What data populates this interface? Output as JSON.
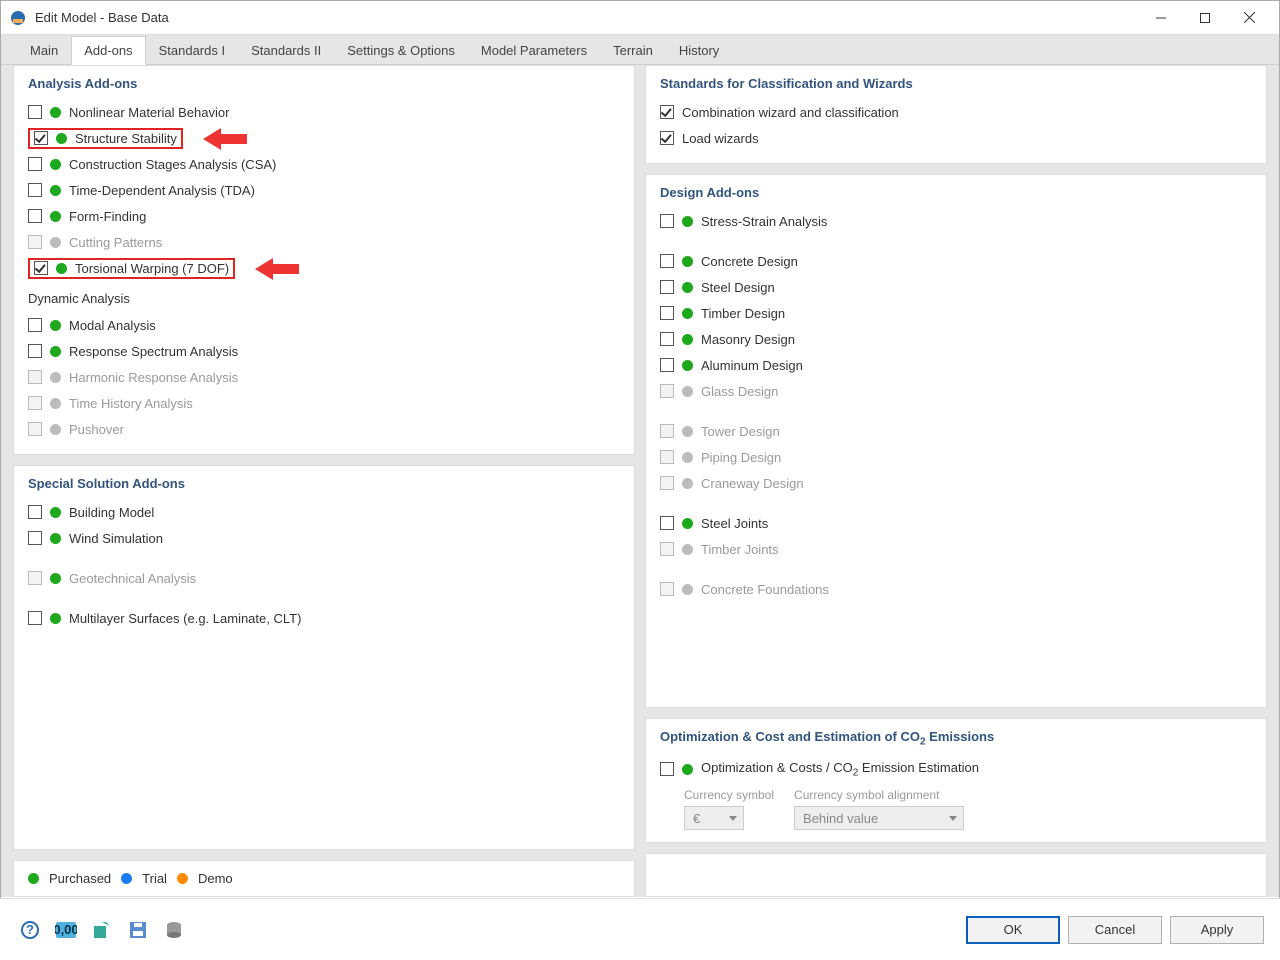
{
  "window": {
    "title": "Edit Model - Base Data"
  },
  "tabs": [
    {
      "label": "Main"
    },
    {
      "label": "Add-ons",
      "active": true
    },
    {
      "label": "Standards I"
    },
    {
      "label": "Standards II"
    },
    {
      "label": "Settings & Options"
    },
    {
      "label": "Model Parameters"
    },
    {
      "label": "Terrain"
    },
    {
      "label": "History"
    }
  ],
  "left": {
    "analysis_title": "Analysis Add-ons",
    "analysis": [
      {
        "label": "Nonlinear Material Behavior",
        "checked": false,
        "status": "green",
        "disabled": false,
        "highlight": false
      },
      {
        "label": "Structure Stability",
        "checked": true,
        "status": "green",
        "disabled": false,
        "highlight": true
      },
      {
        "label": "Construction Stages Analysis (CSA)",
        "checked": false,
        "status": "green",
        "disabled": false,
        "highlight": false
      },
      {
        "label": "Time-Dependent Analysis (TDA)",
        "checked": false,
        "status": "green",
        "disabled": false,
        "highlight": false
      },
      {
        "label": "Form-Finding",
        "checked": false,
        "status": "green",
        "disabled": false,
        "highlight": false
      },
      {
        "label": "Cutting Patterns",
        "checked": false,
        "status": "grey",
        "disabled": true,
        "highlight": false
      },
      {
        "label": "Torsional Warping (7 DOF)",
        "checked": true,
        "status": "green",
        "disabled": false,
        "highlight": true
      }
    ],
    "dynamic_title": "Dynamic Analysis",
    "dynamic": [
      {
        "label": "Modal Analysis",
        "checked": false,
        "status": "green",
        "disabled": false
      },
      {
        "label": "Response Spectrum Analysis",
        "checked": false,
        "status": "green",
        "disabled": false
      },
      {
        "label": "Harmonic Response Analysis",
        "checked": false,
        "status": "grey",
        "disabled": true
      },
      {
        "label": "Time History Analysis",
        "checked": false,
        "status": "grey",
        "disabled": true
      },
      {
        "label": "Pushover",
        "checked": false,
        "status": "grey",
        "disabled": true
      }
    ],
    "special_title": "Special Solution Add-ons",
    "special": [
      {
        "label": "Building Model",
        "checked": false,
        "status": "green",
        "disabled": false,
        "gap": false
      },
      {
        "label": "Wind Simulation",
        "checked": false,
        "status": "green",
        "disabled": false,
        "gap": false
      },
      {
        "label": "Geotechnical Analysis",
        "checked": false,
        "status": "green",
        "disabled": true,
        "gap": true
      },
      {
        "label": "Multilayer Surfaces (e.g. Laminate, CLT)",
        "checked": false,
        "status": "green",
        "disabled": false,
        "gap": true
      }
    ]
  },
  "right": {
    "standards_title": "Standards for Classification and Wizards",
    "standards": [
      {
        "label": "Combination wizard and classification",
        "checked": true
      },
      {
        "label": "Load wizards",
        "checked": true
      }
    ],
    "design_title": "Design Add-ons",
    "design": [
      {
        "label": "Stress-Strain Analysis",
        "checked": false,
        "status": "green",
        "disabled": false,
        "gap": false
      },
      {
        "label": "Concrete Design",
        "checked": false,
        "status": "green",
        "disabled": false,
        "gap": true
      },
      {
        "label": "Steel Design",
        "checked": false,
        "status": "green",
        "disabled": false,
        "gap": false
      },
      {
        "label": "Timber Design",
        "checked": false,
        "status": "green",
        "disabled": false,
        "gap": false
      },
      {
        "label": "Masonry Design",
        "checked": false,
        "status": "green",
        "disabled": false,
        "gap": false
      },
      {
        "label": "Aluminum Design",
        "checked": false,
        "status": "green",
        "disabled": false,
        "gap": false
      },
      {
        "label": "Glass Design",
        "checked": false,
        "status": "grey",
        "disabled": true,
        "gap": false
      },
      {
        "label": "Tower Design",
        "checked": false,
        "status": "grey",
        "disabled": true,
        "gap": true
      },
      {
        "label": "Piping Design",
        "checked": false,
        "status": "grey",
        "disabled": true,
        "gap": false
      },
      {
        "label": "Craneway Design",
        "checked": false,
        "status": "grey",
        "disabled": true,
        "gap": false
      },
      {
        "label": "Steel Joints",
        "checked": false,
        "status": "green",
        "disabled": false,
        "gap": true
      },
      {
        "label": "Timber Joints",
        "checked": false,
        "status": "grey",
        "disabled": true,
        "gap": false
      },
      {
        "label": "Concrete Foundations",
        "checked": false,
        "status": "grey",
        "disabled": true,
        "gap": true
      }
    ],
    "opt_title": "Optimization & Cost and Estimation of CO",
    "opt_sub": "2",
    "opt_title2": " Emissions",
    "opt_row": {
      "label_a": "Optimization & Costs / CO",
      "sub": "2",
      "label_b": " Emission Estimation",
      "checked": false,
      "status": "green"
    },
    "currency_label": "Currency symbol",
    "currency_value": "€",
    "align_label": "Currency symbol alignment",
    "align_value": "Behind value"
  },
  "legend": {
    "purchased": "Purchased",
    "trial": "Trial",
    "demo": "Demo"
  },
  "buttons": {
    "ok": "OK",
    "cancel": "Cancel",
    "apply": "Apply"
  }
}
